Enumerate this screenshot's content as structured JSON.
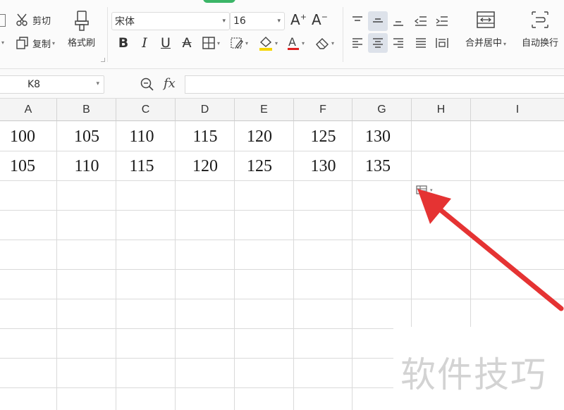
{
  "ribbon": {
    "cut_label": "剪切",
    "copy_label": "复制",
    "format_painter_label": "格式刷",
    "font_name": "宋体",
    "font_size": "16",
    "merge_center_label": "合并居中",
    "wrap_text_label": "自动换行",
    "font_color": "#e02020",
    "fill_color": "#f5d400",
    "accent_green": "#3bb567"
  },
  "formula_bar": {
    "name_box": "K8",
    "fx_label": "fx",
    "formula": ""
  },
  "sheet": {
    "columns": [
      "A",
      "B",
      "C",
      "D",
      "E",
      "F",
      "G",
      "H",
      "I"
    ],
    "rows": [
      [
        "100",
        "105",
        "110",
        "115",
        "120",
        "125",
        "130"
      ],
      [
        "105",
        "110",
        "115",
        "120",
        "125",
        "130",
        "135"
      ]
    ]
  },
  "annotation": {
    "arrow_color": "#e53333",
    "watermark": "软件技巧"
  }
}
